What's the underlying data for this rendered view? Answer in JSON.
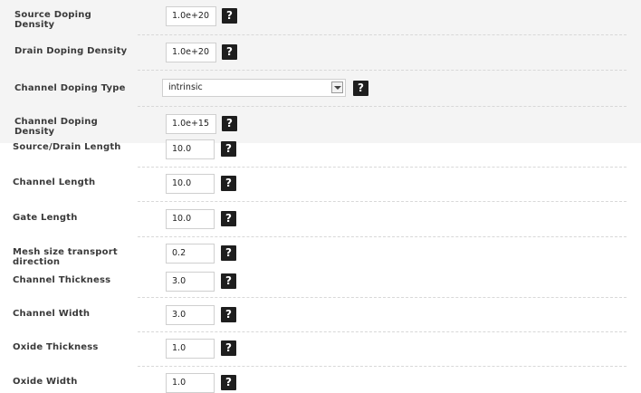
{
  "help_glyph": "?",
  "fields": {
    "source_doping_density": {
      "label": "Source Doping Density",
      "value": "1.0e+20"
    },
    "drain_doping_density": {
      "label": "Drain Doping Density",
      "value": "1.0e+20"
    },
    "channel_doping_type": {
      "label": "Channel Doping Type",
      "value": "intrinsic"
    },
    "channel_doping_density": {
      "label": "Channel Doping Density",
      "value": "1.0e+15"
    },
    "source_drain_length": {
      "label": "Source/Drain Length",
      "value": "10.0"
    },
    "channel_length": {
      "label": "Channel Length",
      "value": "10.0"
    },
    "gate_length": {
      "label": "Gate Length",
      "value": "10.0"
    },
    "mesh_size": {
      "label": "Mesh size transport direction",
      "value": "0.2"
    },
    "channel_thickness": {
      "label": "Channel Thickness",
      "value": "3.0"
    },
    "channel_width": {
      "label": "Channel Width",
      "value": "3.0"
    },
    "oxide_thickness": {
      "label": "Oxide Thickness",
      "value": "1.0"
    },
    "oxide_width": {
      "label": "Oxide Width",
      "value": "1.0"
    }
  }
}
